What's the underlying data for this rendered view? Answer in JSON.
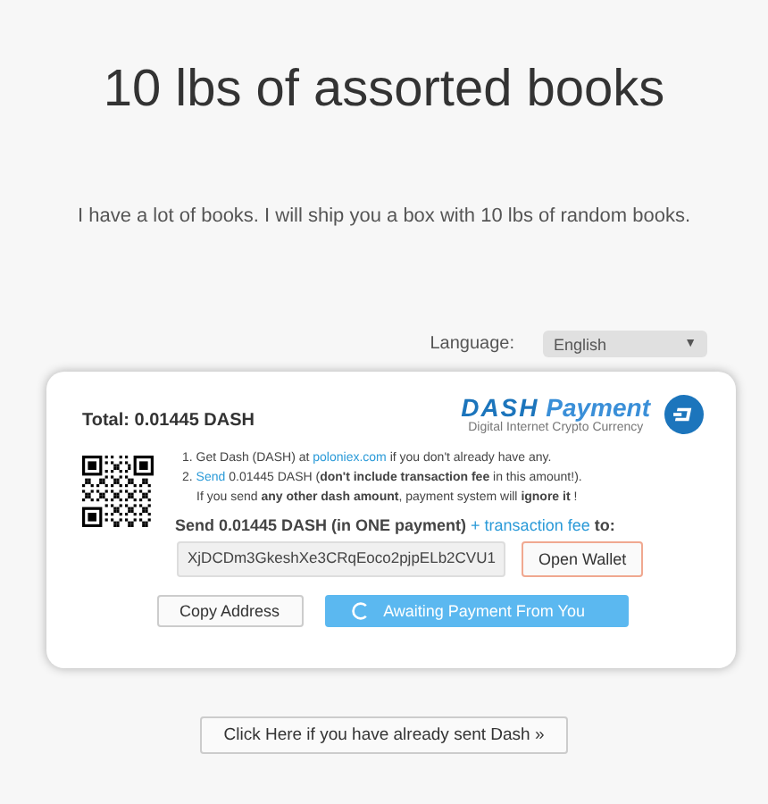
{
  "title": "10 lbs of assorted books",
  "description": "I have a lot of books.  I will ship you a box with 10 lbs of random books.",
  "language": {
    "label": "Language:",
    "value": "English",
    "caret": "▼"
  },
  "payment": {
    "total": "Total: 0.01445 DASH",
    "logo": {
      "brand": "DASH",
      "word": "Payment",
      "tagline": "Digital Internet Crypto Currency"
    },
    "steps": [
      [
        {
          "kind": "text",
          "text": "1. Get Dash (DASH) at "
        },
        {
          "kind": "link",
          "text": "poloniex.com"
        },
        {
          "kind": "text",
          "text": " if you don't already have any."
        }
      ],
      [
        {
          "kind": "text",
          "text": "2. "
        },
        {
          "kind": "link",
          "text": "Send"
        },
        {
          "kind": "text",
          "text": " 0.01445 DASH (**don't include transaction fee** in this amount!)."
        }
      ]
    ],
    "note": "If you send **any other dash amount**, payment system will **ignore it** !",
    "send": [
      {
        "kind": "text",
        "text": "Send 0.01445 DASH (in ONE payment)"
      },
      {
        "kind": "link",
        "text": " + transaction fee"
      },
      {
        "kind": "text",
        "text": " to:"
      }
    ],
    "address": "XjDCDm3GkeshXe3CRqEoco2pjpELb2CVU1",
    "open_wallet": "Open Wallet",
    "copy": "Copy Address",
    "status": "Awaiting Payment From You"
  },
  "sent_button": "Click Here if you have already sent Dash »"
}
